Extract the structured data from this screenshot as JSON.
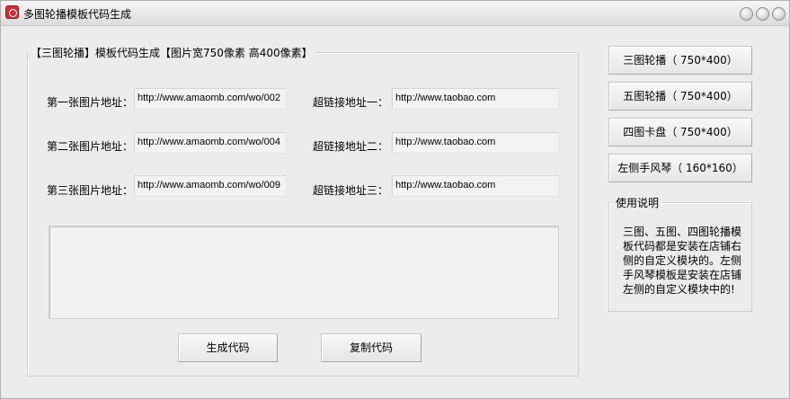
{
  "window": {
    "title": "多图轮播模板代码生成"
  },
  "group": {
    "legend": "【三图轮播】模板代码生成【图片宽750像素 高400像素】",
    "rows": [
      {
        "img_label": "第一张图片地址：",
        "img_value": "http://www.amaomb.com/wo/002",
        "link_label": "超链接地址一：",
        "link_value": "http://www.taobao.com"
      },
      {
        "img_label": "第二张图片地址：",
        "img_value": "http://www.amaomb.com/wo/004",
        "link_label": "超链接地址二：",
        "link_value": "http://www.taobao.com"
      },
      {
        "img_label": "第三张图片地址：",
        "img_value": "http://www.amaomb.com/wo/009",
        "link_label": "超链接地址三：",
        "link_value": "http://www.taobao.com"
      }
    ],
    "output": "",
    "generate_label": "生成代码",
    "copy_label": "复制代码"
  },
  "sidebar": {
    "buttons": [
      {
        "label": "三图轮播（ 750*400）"
      },
      {
        "label": "五图轮播（ 750*400）"
      },
      {
        "label": "四图卡盘（ 750*400）"
      },
      {
        "label": "左侧手风琴（ 160*160）"
      }
    ],
    "help_title": "使用说明",
    "help_text": "三图、五图、四图轮播模板代码都是安装在店铺右侧的自定义模块的。左侧手风琴模板是安装在店铺左侧的自定义模块中的!"
  }
}
